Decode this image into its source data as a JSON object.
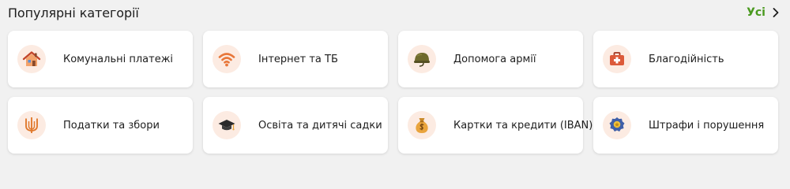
{
  "section": {
    "title": "Популярні категорії",
    "see_all_label": "Усі"
  },
  "colors": {
    "accent": "#4a9a1f",
    "icon_background": "#fcebe2",
    "icon_primary": "#e8773a"
  },
  "categories": [
    {
      "label": "Комунальні платежі",
      "icon": "house-icon"
    },
    {
      "label": "Інтернет та ТБ",
      "icon": "wifi-icon"
    },
    {
      "label": "Допомога армії",
      "icon": "helmet-icon"
    },
    {
      "label": "Благодійність",
      "icon": "first-aid-kit-icon"
    },
    {
      "label": "Податки та збори",
      "icon": "trident-icon"
    },
    {
      "label": "Освіта та дитячі садки",
      "icon": "graduation-cap-icon"
    },
    {
      "label": "Картки та кредити (IBAN)",
      "icon": "money-bag-icon"
    },
    {
      "label": "Штрафи і порушення",
      "icon": "police-badge-icon"
    }
  ]
}
